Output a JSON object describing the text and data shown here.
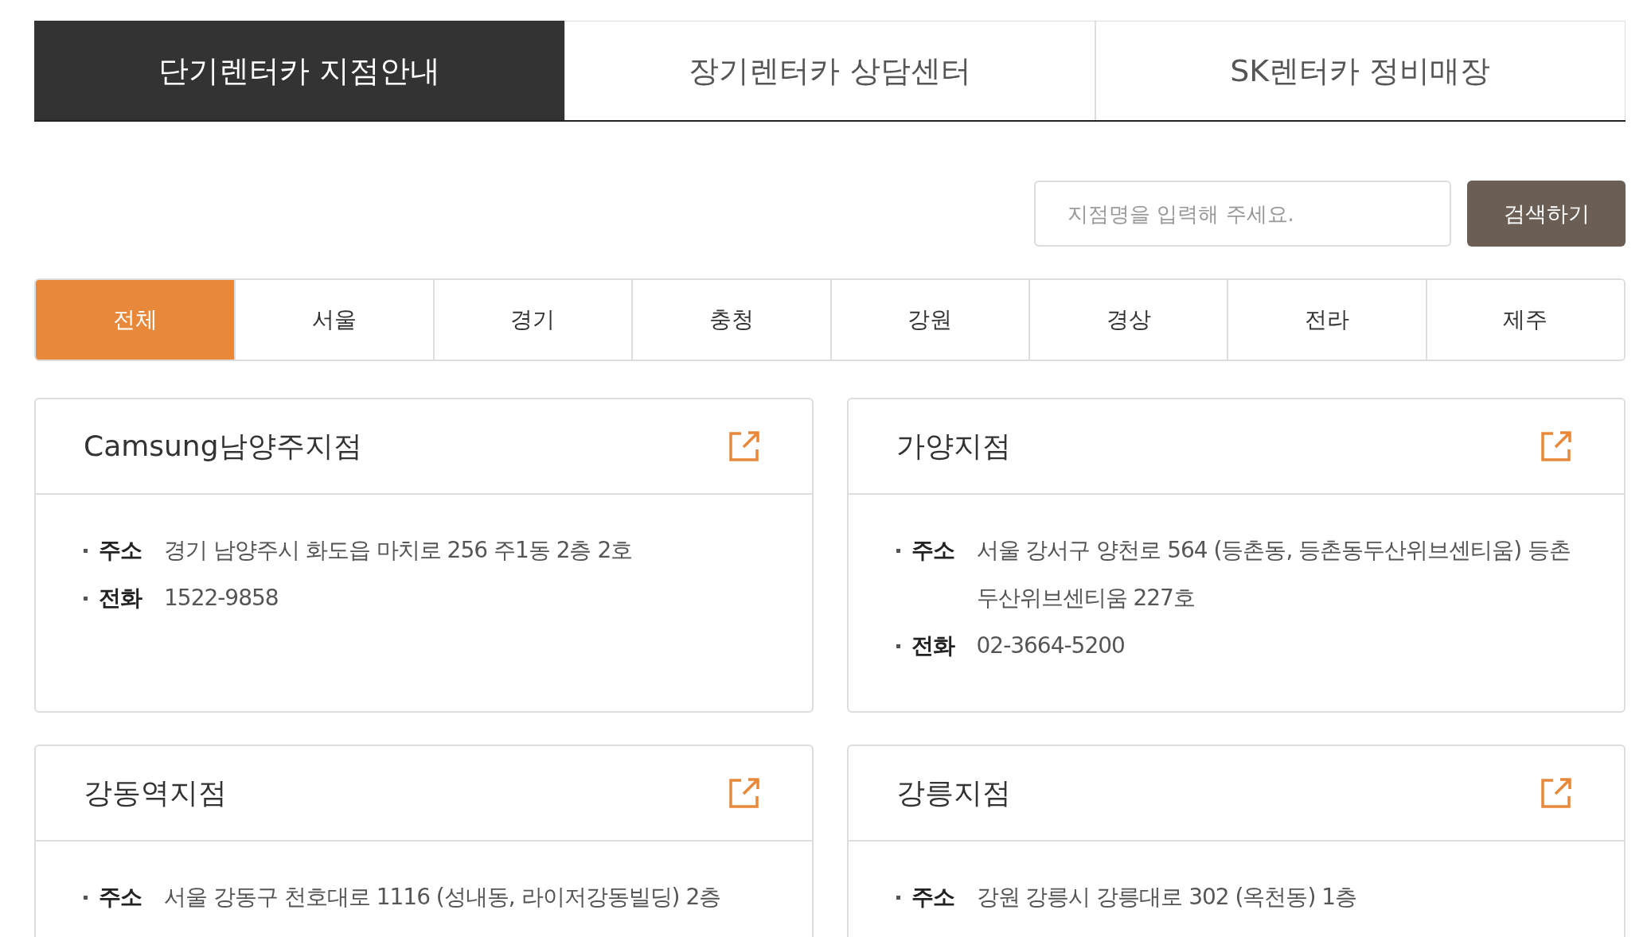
{
  "main_tabs": [
    {
      "label": "단기렌터카 지점안내",
      "selected": true
    },
    {
      "label": "장기렌터카 상담센터",
      "selected": false
    },
    {
      "label": "SK렌터카 정비매장",
      "selected": false
    }
  ],
  "search": {
    "placeholder": "지점명을 입력해 주세요.",
    "button": "검색하기"
  },
  "regions": [
    {
      "label": "전체",
      "selected": true
    },
    {
      "label": "서울",
      "selected": false
    },
    {
      "label": "경기",
      "selected": false
    },
    {
      "label": "충청",
      "selected": false
    },
    {
      "label": "강원",
      "selected": false
    },
    {
      "label": "경상",
      "selected": false
    },
    {
      "label": "전라",
      "selected": false
    },
    {
      "label": "제주",
      "selected": false
    }
  ],
  "branches": [
    {
      "name": "Camsung남양주지점",
      "rows": [
        {
          "label": "주소",
          "value": "경기 남양주시 화도읍 마치로 256 주1동 2층 2호"
        },
        {
          "label": "전화",
          "value": "1522-9858"
        }
      ]
    },
    {
      "name": "가양지점",
      "rows": [
        {
          "label": "주소",
          "value": "서울 강서구 양천로 564 (등촌동, 등촌동두산위브센티움) 등촌 두산위브센티움 227호"
        },
        {
          "label": "전화",
          "value": "02-3664-5200"
        }
      ]
    },
    {
      "name": "강동역지점",
      "rows": [
        {
          "label": "주소",
          "value": "서울 강동구 천호대로 1116 (성내동, 라이저강동빌딩) 2층"
        }
      ]
    },
    {
      "name": "강릉지점",
      "rows": [
        {
          "label": "주소",
          "value": "강원 강릉시 강릉대로 302 (옥천동) 1층"
        }
      ]
    }
  ]
}
